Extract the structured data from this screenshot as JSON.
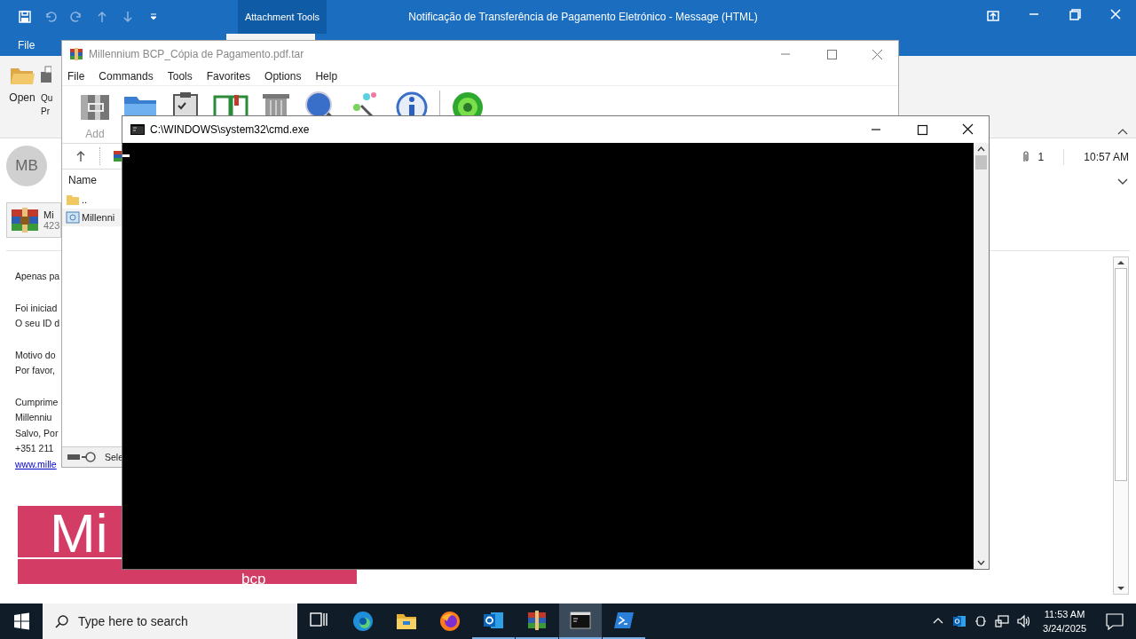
{
  "outlook": {
    "title": "Notificação de Transferência de Pagamento Eletrónico  -  Message (HTML)",
    "context_tab": "Attachment Tools",
    "ribbon_tabs": [
      {
        "label": "File",
        "selected": false
      },
      {
        "selected": true
      }
    ],
    "ribbon_buttons": [
      {
        "kind": "open",
        "lines": [
          "Open"
        ]
      },
      {
        "kind": "print",
        "lines": [
          "Qu",
          "Pr"
        ]
      }
    ]
  },
  "message": {
    "avatar": "MB",
    "attachment_count": "1",
    "time": "10:57 AM",
    "attachment": {
      "name": "Mi",
      "size": "423"
    },
    "paragraphs": [
      [
        "Apenas pa"
      ],
      [
        "Foi iniciad",
        "O seu ID d"
      ],
      [
        "Motivo do",
        "Por favor,"
      ],
      [
        "Cumprime",
        "Millenniu",
        "Salvo, Por",
        "+351 211"
      ]
    ],
    "link": "www.mille",
    "banner": {
      "text": "Mi",
      "sub": "bcp"
    }
  },
  "winrar": {
    "title": "Millennium BCP_Cópia de Pagamento.pdf.tar",
    "menu": [
      "File",
      "Commands",
      "Tools",
      "Favorites",
      "Options",
      "Help"
    ],
    "toolbar": [
      {
        "kind": "add",
        "label": "Add"
      },
      {
        "kind": "extract"
      },
      {
        "kind": "test"
      },
      {
        "kind": "view"
      },
      {
        "kind": "delete"
      },
      {
        "kind": "find"
      },
      {
        "kind": "wizard"
      },
      {
        "kind": "info"
      },
      {
        "kind": "virus"
      }
    ],
    "column": "Name",
    "files": [
      {
        "kind": "folder",
        "name": "..",
        "selected": false
      },
      {
        "kind": "file",
        "name": "Millenni",
        "selected": true
      }
    ],
    "status": "Sele"
  },
  "cmd": {
    "title": "C:\\WINDOWS\\system32\\cmd.exe"
  },
  "taskbar": {
    "search_placeholder": "Type here to search",
    "apps": [
      {
        "kind": "taskview",
        "running": false,
        "selected": false
      },
      {
        "kind": "edge",
        "running": false,
        "selected": false
      },
      {
        "kind": "explorer",
        "running": false,
        "selected": false
      },
      {
        "kind": "firefox",
        "running": false,
        "selected": false
      },
      {
        "kind": "outlook",
        "running": true,
        "selected": false
      },
      {
        "kind": "winrar",
        "running": true,
        "selected": false
      },
      {
        "kind": "cmd",
        "running": true,
        "selected": true
      },
      {
        "kind": "powershell",
        "running": true,
        "selected": false
      }
    ],
    "time": "11:53 AM",
    "date": "3/24/2025"
  }
}
